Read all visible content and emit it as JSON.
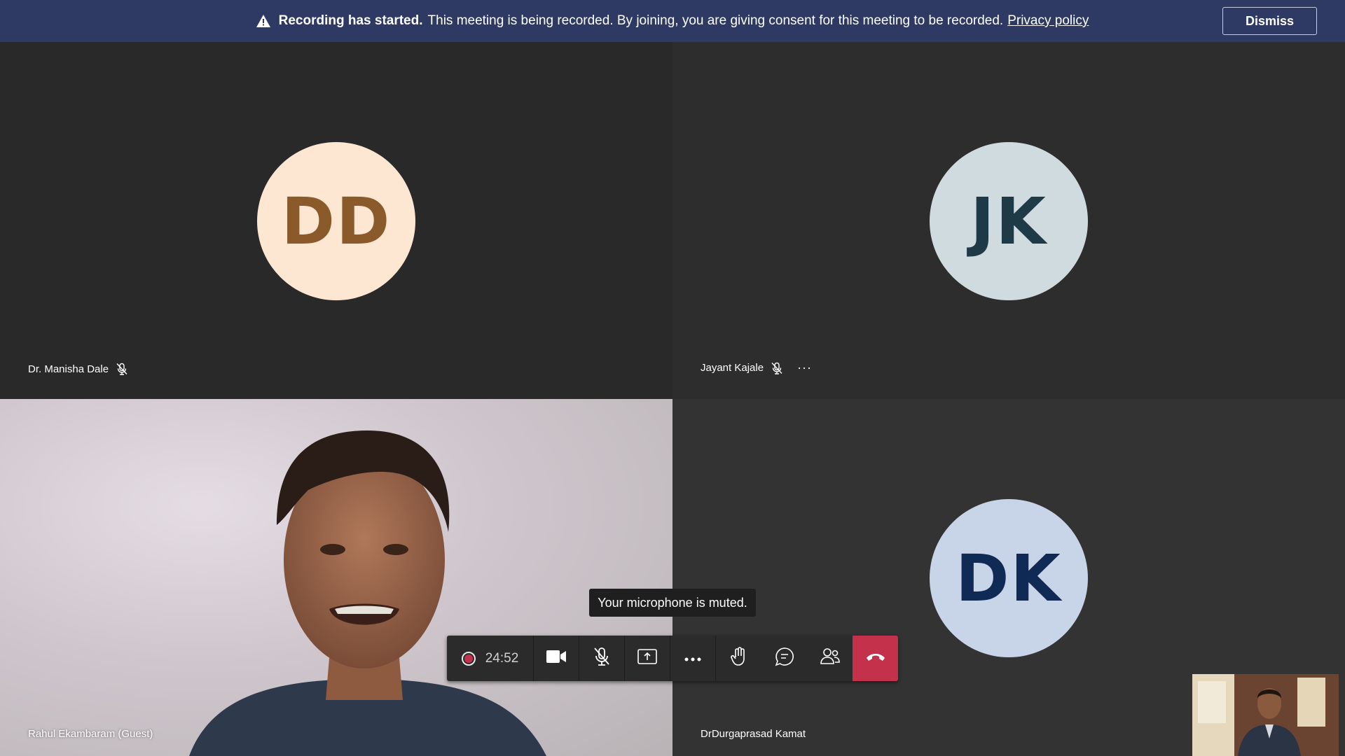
{
  "banner": {
    "title": "Recording has started.",
    "message": "This meeting is being recorded. By joining, you are giving consent for this meeting to be recorded.",
    "link": "Privacy policy",
    "dismiss_label": "Dismiss",
    "icon": "warning-icon"
  },
  "participants": [
    {
      "name": "Dr. Manisha Dale",
      "initials": "DD",
      "muted": true
    },
    {
      "name": "Jayant Kajale",
      "initials": "JK",
      "muted": true,
      "more": "···"
    },
    {
      "name": "Rahul Ekambaram (Guest)",
      "video": true
    },
    {
      "name": "DrDurgaprasad Kamat",
      "initials": "DK"
    }
  ],
  "tooltip": "Your microphone is muted.",
  "controls": {
    "timer": "24:52",
    "icons": [
      "record-icon",
      "camera-icon",
      "mic-off-icon",
      "share-screen-icon",
      "more-icon",
      "raise-hand-icon",
      "chat-icon",
      "participants-icon",
      "hang-up-icon"
    ],
    "hangup_color": "#c4314b"
  },
  "colors": {
    "banner_bg": "#2f3a64",
    "tile_bg": "#292929"
  }
}
